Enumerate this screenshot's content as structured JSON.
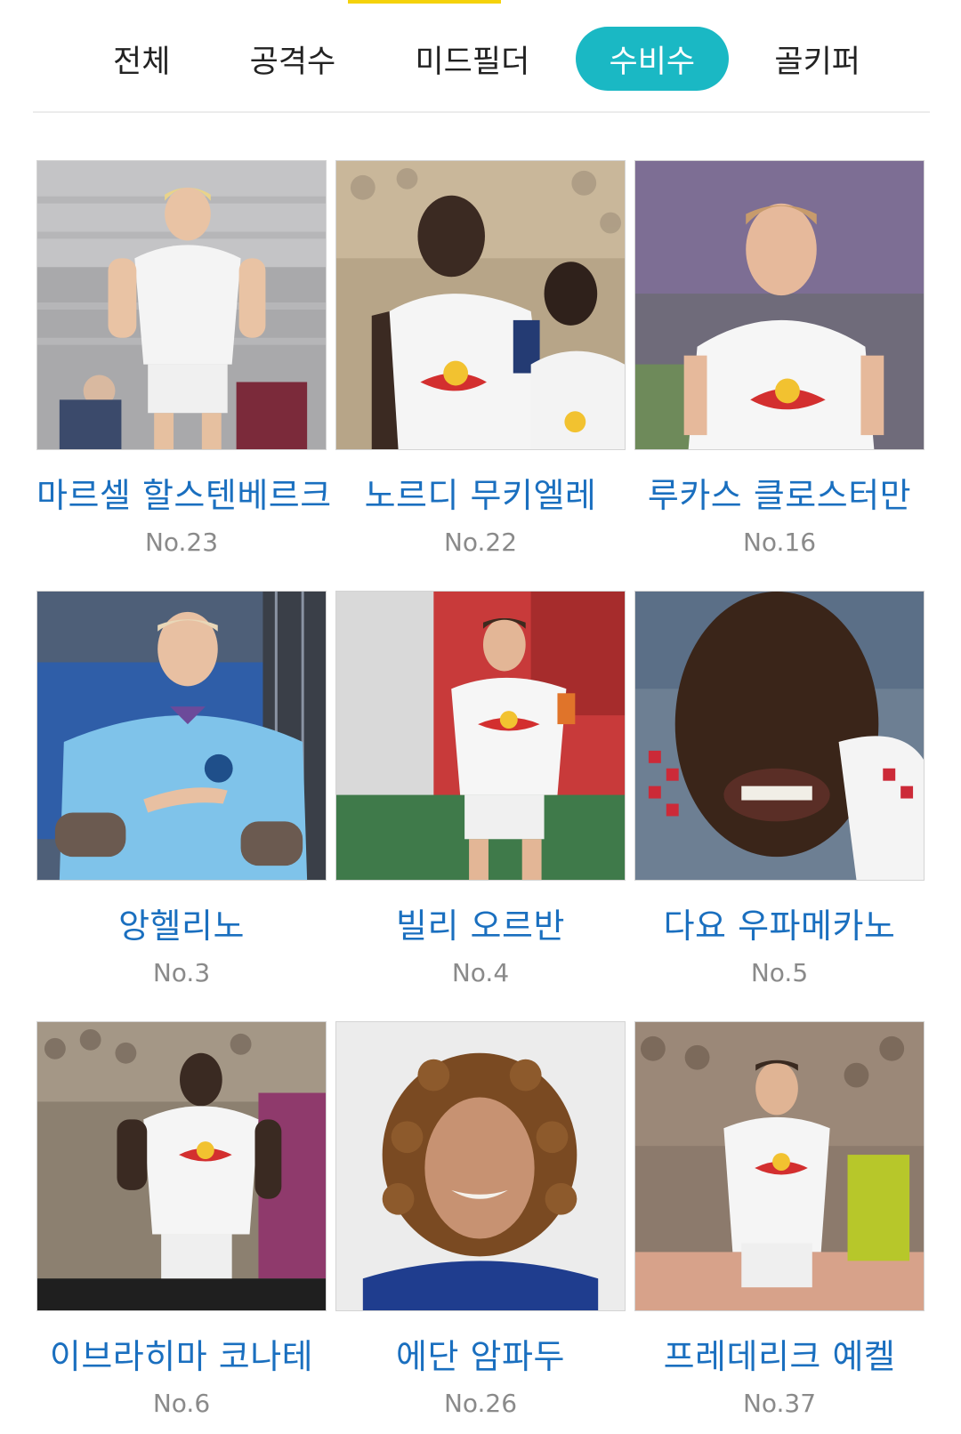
{
  "tabs": [
    {
      "label": "전체",
      "active": false
    },
    {
      "label": "공격수",
      "active": false
    },
    {
      "label": "미드필더",
      "active": false
    },
    {
      "label": "수비수",
      "active": true
    },
    {
      "label": "골키퍼",
      "active": false
    }
  ],
  "accent_color": "#1ab8c4",
  "indicator_color": "#f5d20a",
  "players": [
    {
      "name": "마르셀 할스텐베르크",
      "number": "No.23",
      "photo": "player-photo-kit-white"
    },
    {
      "name": "노르디 무키엘레",
      "number": "No.22",
      "photo": "player-photo-kit-white"
    },
    {
      "name": "루카스 클로스터만",
      "number": "No.16",
      "photo": "player-photo-kit-white"
    },
    {
      "name": "앙헬리노",
      "number": "No.3",
      "photo": "player-photo-kit-sky-blue"
    },
    {
      "name": "빌리 오르반",
      "number": "No.4",
      "photo": "player-photo-kit-white"
    },
    {
      "name": "다요 우파메카노",
      "number": "No.5",
      "photo": "player-photo-closeup"
    },
    {
      "name": "이브라히마 코나테",
      "number": "No.6",
      "photo": "player-photo-kit-white"
    },
    {
      "name": "에단 암파두",
      "number": "No.26",
      "photo": "player-photo-portrait-blue"
    },
    {
      "name": "프레데리크 예켈",
      "number": "No.37",
      "photo": "player-photo-kit-white"
    }
  ]
}
